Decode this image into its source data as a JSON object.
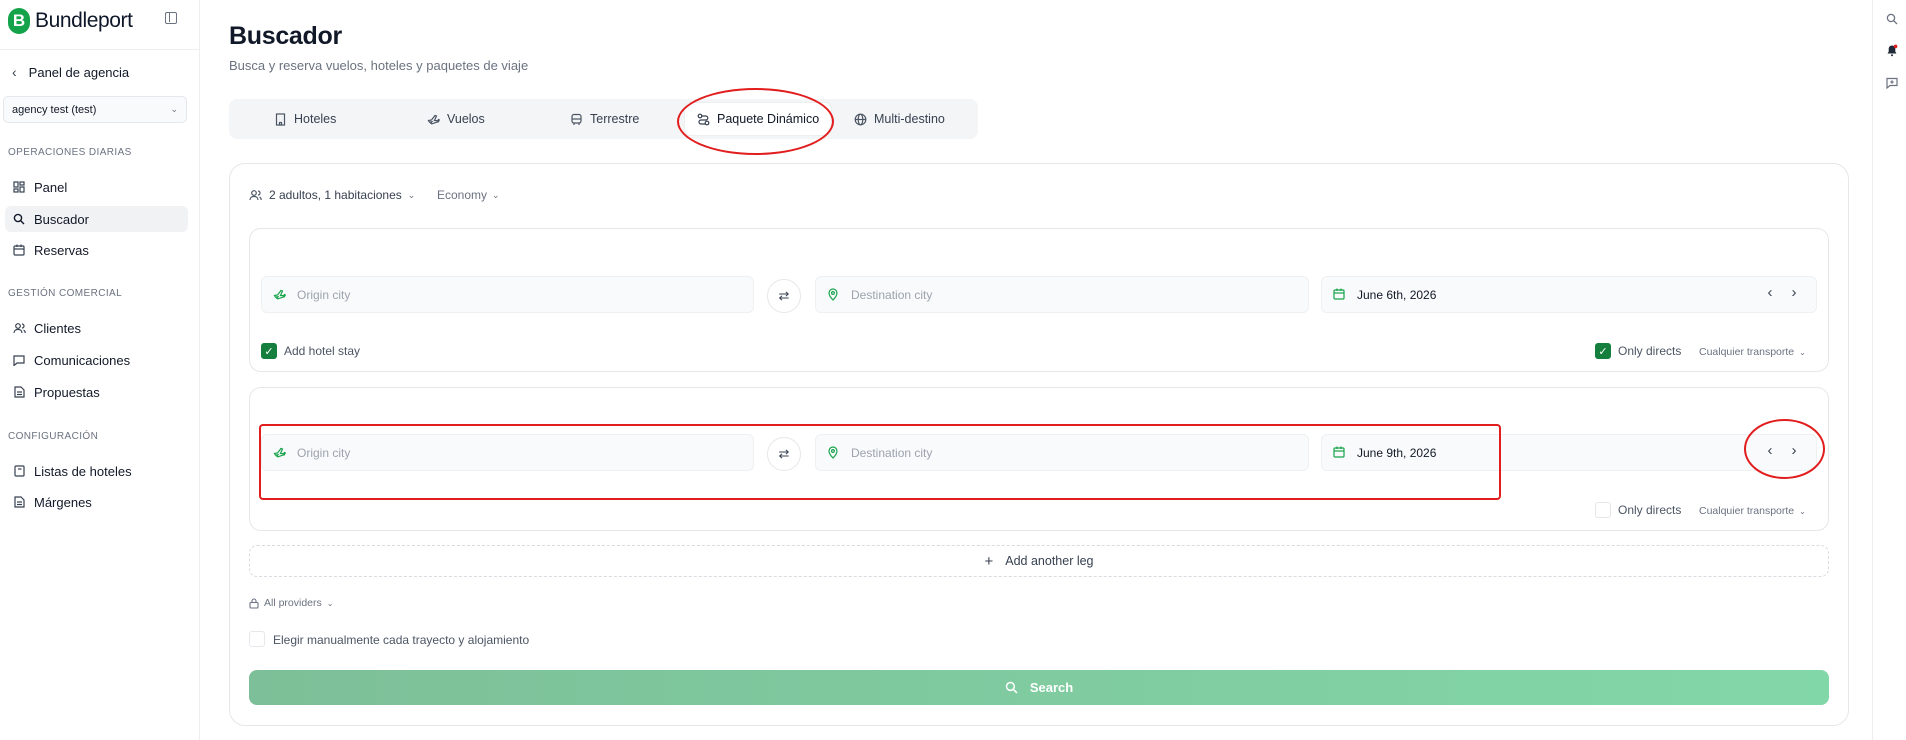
{
  "brand": {
    "name": "Bundleport",
    "logo_letter": "B"
  },
  "sidebar": {
    "back_label": "Panel de agencia",
    "agency_select": "agency test (test)",
    "sections": [
      {
        "title": "OPERACIONES DIARIAS",
        "items": [
          {
            "label": "Panel",
            "icon": "dashboard-icon"
          },
          {
            "label": "Buscador",
            "icon": "search-icon",
            "active": true
          },
          {
            "label": "Reservas",
            "icon": "calendar-icon"
          }
        ]
      },
      {
        "title": "GESTIÓN COMERCIAL",
        "items": [
          {
            "label": "Clientes",
            "icon": "users-icon"
          },
          {
            "label": "Comunicaciones",
            "icon": "message-icon"
          },
          {
            "label": "Propuestas",
            "icon": "document-icon"
          }
        ]
      },
      {
        "title": "CONFIGURACIÓN",
        "items": [
          {
            "label": "Listas de hoteles",
            "icon": "book-icon"
          },
          {
            "label": "Márgenes",
            "icon": "document-icon"
          }
        ]
      }
    ]
  },
  "header": {
    "title": "Buscador",
    "subtitle": "Busca y reserva vuelos, hoteles y paquetes de viaje"
  },
  "tabs": [
    {
      "label": "Hoteles",
      "icon": "building-icon"
    },
    {
      "label": "Vuelos",
      "icon": "plane-icon"
    },
    {
      "label": "Terrestre",
      "icon": "bus-icon"
    },
    {
      "label": "Paquete Dinámico",
      "icon": "route-icon",
      "active": true
    },
    {
      "label": "Multi-destino",
      "icon": "globe-icon"
    }
  ],
  "search": {
    "passengers": "2 adultos, 1 habitaciones",
    "cabin": "Economy",
    "legs": [
      {
        "origin_placeholder": "Origin city",
        "destination_placeholder": "Destination city",
        "date": "June 6th, 2026",
        "add_hotel_label": "Add hotel stay",
        "add_hotel_checked": true,
        "only_directs_label": "Only directs",
        "only_directs_checked": true,
        "transport": "Cualquier transporte"
      },
      {
        "origin_placeholder": "Origin city",
        "destination_placeholder": "Destination city",
        "date": "June 9th, 2026",
        "only_directs_label": "Only directs",
        "only_directs_checked": false,
        "transport": "Cualquier transporte"
      }
    ],
    "add_leg_label": "Add another leg",
    "providers": "All providers",
    "manual_label": "Elegir manualmente cada trayecto y alojamiento",
    "search_button": "Search"
  },
  "colors": {
    "accent": "#15803d",
    "search_button": "#82d7a8",
    "annotation": "#e11d1d"
  }
}
